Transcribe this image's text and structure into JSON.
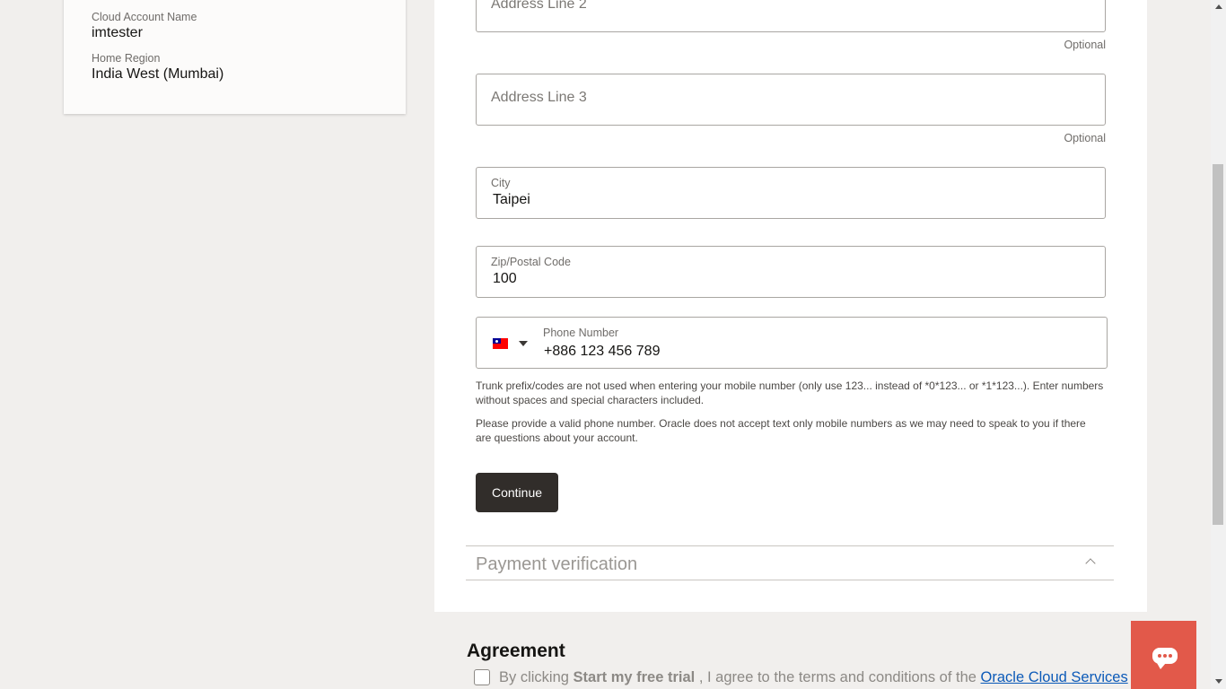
{
  "account": {
    "cloud_account_label": "Cloud Account Name",
    "cloud_account_value": "imtester",
    "home_region_label": "Home Region",
    "home_region_value": "India West (Mumbai)"
  },
  "form": {
    "address2": {
      "placeholder": "Address Line 2",
      "optional": "Optional"
    },
    "address3": {
      "placeholder": "Address Line 3",
      "optional": "Optional"
    },
    "city": {
      "label": "City",
      "value": "Taipei"
    },
    "zip": {
      "label": "Zip/Postal Code",
      "value": "100"
    },
    "phone": {
      "country_flag": "taiwan-flag-icon",
      "label": "Phone Number",
      "value": "+886 123 456 789"
    },
    "help_text_1": "Trunk prefix/codes are not used when entering your mobile number (only use 123... instead of *0*123... or *1*123...). Enter numbers without spaces and special characters included.",
    "help_text_2": "Please provide a valid phone number. Oracle does not accept text only mobile numbers as we may need to speak to you if there are questions about your account.",
    "continue_label": "Continue"
  },
  "payment_section": {
    "title": "Payment verification",
    "icon": "chevron-up-icon"
  },
  "agreement": {
    "title": "Agreement",
    "text_prefix": "By clicking ",
    "text_bold": "Start my free trial",
    "text_middle": " , I agree to the terms and conditions of the ",
    "link_text": "Oracle Cloud Services"
  },
  "chat": {
    "icon": "chat-icon"
  },
  "colors": {
    "background": "#f1efed",
    "panel": "#ffffff",
    "button": "#312d2a",
    "chat_button": "#e2594a",
    "link": "#0c5ab8"
  }
}
